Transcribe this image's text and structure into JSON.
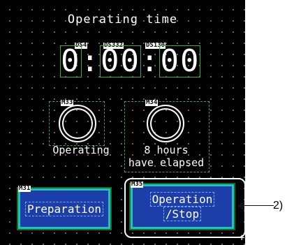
{
  "screen": {
    "title": "Operating time",
    "timer": {
      "hours": "0",
      "minutes": "00",
      "seconds": "00",
      "separator": ":",
      "tags": [
        "DS4",
        "DS332",
        "DS130"
      ]
    },
    "lamps": [
      {
        "tag": "M33",
        "label": "Operating"
      },
      {
        "tag": "M34",
        "label_line1": "8 hours",
        "label_line2": "have elapsed"
      }
    ],
    "buttons": [
      {
        "tag": "M31",
        "label": "Preparation"
      },
      {
        "tag": "M35",
        "label_line1": "Operation",
        "label_line2": "/Stop"
      }
    ],
    "callout": "2)"
  },
  "colors": {
    "background": "#000000",
    "button_fill": "#1d3ea8",
    "button_border": "#22c0c0",
    "outline_green": "#3ea83e"
  }
}
